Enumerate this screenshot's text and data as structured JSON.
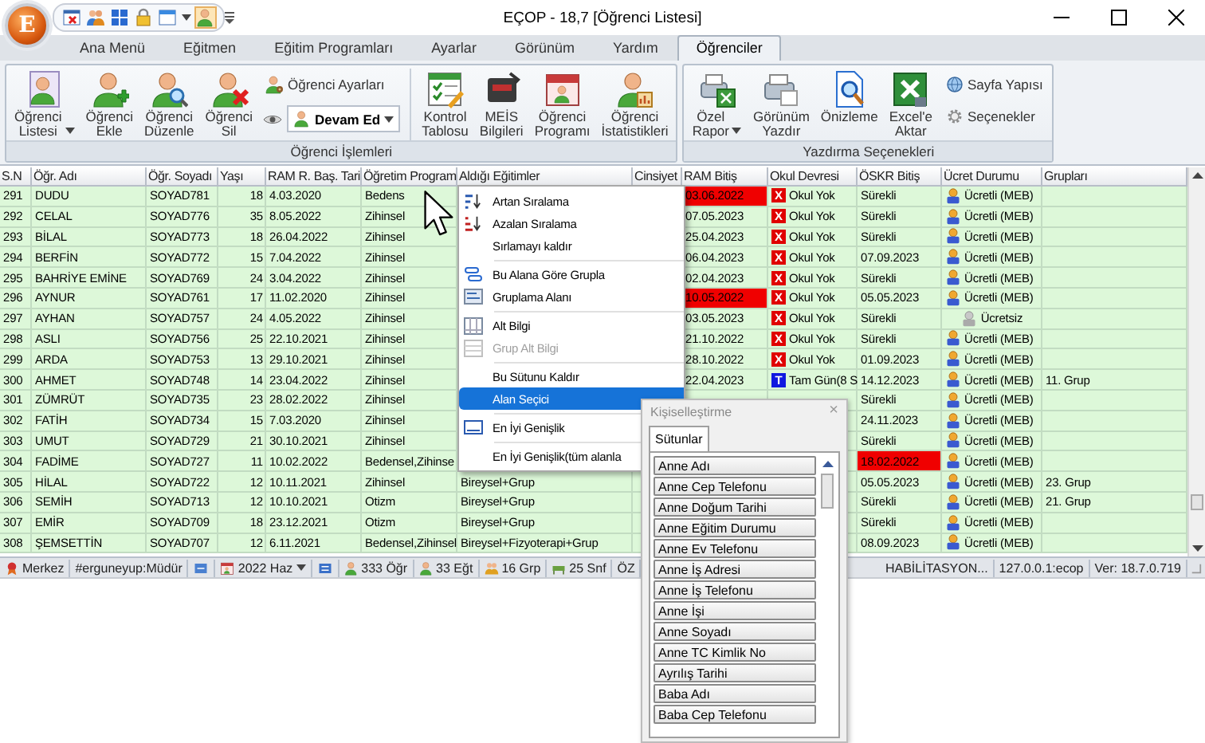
{
  "window": {
    "title": "EÇOP - 18,7 [Öğrenci Listesi]",
    "app_letter": "E"
  },
  "tabs": [
    {
      "label": "Ana Menü",
      "selected": false
    },
    {
      "label": "Eğitmen",
      "selected": false
    },
    {
      "label": "Eğitim Programları",
      "selected": false
    },
    {
      "label": "Ayarlar",
      "selected": false
    },
    {
      "label": "Görünüm",
      "selected": false
    },
    {
      "label": "Yardım",
      "selected": false
    },
    {
      "label": "Öğrenciler",
      "selected": true
    }
  ],
  "ribbon": {
    "groups": [
      {
        "label": "Öğrenci İşlemleri",
        "items": [
          {
            "kind": "large",
            "label": "Öğrenci\nListesi",
            "menu": true
          },
          {
            "kind": "large",
            "label": "Öğrenci\nEkle",
            "menu": false
          },
          {
            "kind": "large",
            "label": "Öğrenci\nDüzenle",
            "menu": false
          },
          {
            "kind": "large",
            "label": "Öğrenci\nSil",
            "menu": false
          },
          {
            "kind": "small",
            "label": "Öğrenci Ayarları"
          },
          {
            "kind": "combo",
            "value": "Devam Ed"
          },
          {
            "kind": "large",
            "label": "Kontrol\nTablosu",
            "menu": false
          },
          {
            "kind": "large",
            "label": "MEİS\nBilgileri",
            "menu": false
          },
          {
            "kind": "large",
            "label": "Öğrenci\nProgramı",
            "menu": false
          },
          {
            "kind": "large",
            "label": "Öğrenci\nİstatistikleri",
            "menu": false
          }
        ]
      },
      {
        "label": "Yazdırma Seçenekleri",
        "items": [
          {
            "kind": "large",
            "label": "Özel\nRapor",
            "menu": true
          },
          {
            "kind": "large",
            "label": "Görünüm\nYazdır",
            "menu": false
          },
          {
            "kind": "large",
            "label": "Önizleme",
            "menu": false
          },
          {
            "kind": "large",
            "label": "Excel'e\nAktar",
            "menu": false
          },
          {
            "kind": "small",
            "label": "Sayfa Yapısı"
          },
          {
            "kind": "small",
            "label": "Seçenekler"
          }
        ]
      }
    ]
  },
  "table": {
    "columns": [
      "S.N",
      "Öğr. Adı",
      "Öğr. Soyadı",
      "Yaşı",
      "RAM R. Baş. Tari",
      "Öğretim Program",
      "Aldığı Eğitimler",
      "Cinsiyet",
      "RAM Bitiş",
      "Okul Devresi",
      "ÖSKR Bitiş",
      "Ücret Durumu",
      "Grupları"
    ],
    "rows": [
      {
        "no": "291",
        "name": "DUDU",
        "surname": "SOYAD781",
        "age": "18",
        "ram_start": "4.03.2020",
        "program": "Bedens",
        "ram_end": "03.06.2022",
        "ram_end_expired": true,
        "school": {
          "kind": "none",
          "badge": "X",
          "text": "Okul Yok"
        },
        "oskr_end": "Sürekli",
        "oskr_expired": false,
        "fee": {
          "kind": "paid",
          "text": "Ücretli (MEB)"
        }
      },
      {
        "no": "292",
        "name": "CELAL",
        "surname": "SOYAD776",
        "age": "35",
        "ram_start": "8.05.2022",
        "program": "Zihinsel",
        "ram_end": "07.05.2023",
        "ram_end_expired": false,
        "school": {
          "kind": "none",
          "badge": "X",
          "text": "Okul Yok"
        },
        "oskr_end": "Sürekli",
        "oskr_expired": false,
        "fee": {
          "kind": "paid",
          "text": "Ücretli (MEB)"
        }
      },
      {
        "no": "293",
        "name": "BİLAL",
        "surname": "SOYAD773",
        "age": "18",
        "ram_start": "26.04.2022",
        "program": "Zihinsel",
        "ram_end": "25.04.2023",
        "ram_end_expired": false,
        "school": {
          "kind": "none",
          "badge": "X",
          "text": "Okul Yok"
        },
        "oskr_end": "Sürekli",
        "oskr_expired": false,
        "fee": {
          "kind": "paid",
          "text": "Ücretli (MEB)"
        }
      },
      {
        "no": "294",
        "name": "BERFİN",
        "surname": "SOYAD772",
        "age": "15",
        "ram_start": "7.04.2022",
        "program": "Zihinsel",
        "ram_end": "06.04.2023",
        "ram_end_expired": false,
        "school": {
          "kind": "none",
          "badge": "X",
          "text": "Okul Yok"
        },
        "oskr_end": "07.09.2023",
        "oskr_expired": false,
        "fee": {
          "kind": "paid",
          "text": "Ücretli (MEB)"
        }
      },
      {
        "no": "295",
        "name": "BAHRİYE EMİNE",
        "surname": "SOYAD769",
        "age": "24",
        "ram_start": "3.04.2022",
        "program": "Zihinsel",
        "ram_end": "02.04.2023",
        "ram_end_expired": false,
        "school": {
          "kind": "none",
          "badge": "X",
          "text": "Okul Yok"
        },
        "oskr_end": "Sürekli",
        "oskr_expired": false,
        "fee": {
          "kind": "paid",
          "text": "Ücretli (MEB)"
        }
      },
      {
        "no": "296",
        "name": "AYNUR",
        "surname": "SOYAD761",
        "age": "17",
        "ram_start": "11.02.2020",
        "program": "Zihinsel",
        "ram_end": "10.05.2022",
        "ram_end_expired": true,
        "school": {
          "kind": "none",
          "badge": "X",
          "text": "Okul Yok"
        },
        "oskr_end": "05.05.2023",
        "oskr_expired": false,
        "fee": {
          "kind": "paid",
          "text": "Ücretli (MEB)"
        }
      },
      {
        "no": "297",
        "name": "AYHAN",
        "surname": "SOYAD757",
        "age": "24",
        "ram_start": "4.05.2022",
        "program": "Zihinsel",
        "ram_end": "03.05.2023",
        "ram_end_expired": false,
        "school": {
          "kind": "none",
          "badge": "X",
          "text": "Okul Yok"
        },
        "oskr_end": "Sürekli",
        "oskr_expired": false,
        "fee": {
          "kind": "free",
          "text": "Ücretsiz"
        }
      },
      {
        "no": "298",
        "name": "ASLI",
        "surname": "SOYAD756",
        "age": "25",
        "ram_start": "22.10.2021",
        "program": "Zihinsel",
        "ram_end": "21.10.2022",
        "ram_end_expired": false,
        "school": {
          "kind": "none",
          "badge": "X",
          "text": "Okul Yok"
        },
        "oskr_end": "Sürekli",
        "oskr_expired": false,
        "fee": {
          "kind": "paid",
          "text": "Ücretli (MEB)"
        }
      },
      {
        "no": "299",
        "name": "ARDA",
        "surname": "SOYAD753",
        "age": "13",
        "ram_start": "29.10.2021",
        "program": "Zihinsel",
        "ram_end": "28.10.2022",
        "ram_end_expired": false,
        "school": {
          "kind": "none",
          "badge": "X",
          "text": "Okul Yok"
        },
        "oskr_end": "01.09.2023",
        "oskr_expired": false,
        "fee": {
          "kind": "paid",
          "text": "Ücretli (MEB)"
        }
      },
      {
        "no": "300",
        "name": "AHMET",
        "surname": "SOYAD748",
        "age": "14",
        "ram_start": "23.04.2022",
        "program": "Zihinsel",
        "ram_end": "22.04.2023",
        "ram_end_expired": false,
        "school": {
          "kind": "full",
          "badge": "T",
          "text": "Tam Gün(8 S"
        },
        "oskr_end": "14.12.2023",
        "oskr_expired": false,
        "fee": {
          "kind": "paid",
          "text": "Ücretli (MEB)"
        },
        "group": "11. Grup"
      },
      {
        "no": "301",
        "name": "ZÜMRÜT",
        "surname": "SOYAD735",
        "age": "23",
        "ram_start": "28.02.2022",
        "program": "Zihinsel",
        "oskr_end": "Sürekli",
        "oskr_expired": false,
        "fee": {
          "kind": "paid",
          "text": "Ücretli (MEB)"
        }
      },
      {
        "no": "302",
        "name": "FATİH",
        "surname": "SOYAD734",
        "age": "15",
        "ram_start": "7.03.2020",
        "program": "Zihinsel",
        "oskr_end": "24.11.2023",
        "oskr_expired": false,
        "fee": {
          "kind": "paid",
          "text": "Ücretli (MEB)"
        }
      },
      {
        "no": "303",
        "name": "UMUT",
        "surname": "SOYAD729",
        "age": "21",
        "ram_start": "30.10.2021",
        "program": "Zihinsel",
        "oskr_end": "Sürekli",
        "oskr_expired": false,
        "fee": {
          "kind": "paid",
          "text": "Ücretli (MEB)"
        }
      },
      {
        "no": "304",
        "name": "FADİME",
        "surname": "SOYAD727",
        "age": "11",
        "ram_start": "10.02.2022",
        "program": "Bedensel,Zihinse",
        "oskr_end": "18.02.2022",
        "oskr_expired": true,
        "fee": {
          "kind": "paid",
          "text": "Ücretli (MEB)"
        }
      },
      {
        "no": "305",
        "name": "HİLAL",
        "surname": "SOYAD722",
        "age": "12",
        "ram_start": "10.11.2021",
        "program": "Zihinsel",
        "education": "Bireysel+Grup",
        "oskr_end": "05.05.2023",
        "oskr_expired": false,
        "fee": {
          "kind": "paid",
          "text": "Ücretli (MEB)"
        },
        "group": "23. Grup"
      },
      {
        "no": "306",
        "name": "SEMİH",
        "surname": "SOYAD713",
        "age": "12",
        "ram_start": "10.10.2021",
        "program": "Otizm",
        "education": "Bireysel+Grup",
        "oskr_end": "Sürekli",
        "oskr_expired": false,
        "fee": {
          "kind": "paid",
          "text": "Ücretli (MEB)"
        },
        "group": "21. Grup"
      },
      {
        "no": "307",
        "name": "EMİR",
        "surname": "SOYAD709",
        "age": "18",
        "ram_start": "23.12.2021",
        "program": "Otizm",
        "education": "Bireysel+Grup",
        "oskr_end": "Sürekli",
        "oskr_expired": false,
        "fee": {
          "kind": "paid",
          "text": "Ücretli (MEB)"
        }
      },
      {
        "no": "308",
        "name": "ŞEMSETTİN",
        "surname": "SOYAD707",
        "age": "12",
        "ram_start": "6.11.2021",
        "program": "Bedensel,Zihinsel",
        "education": "Bireysel+Fizyoterapi+Grup",
        "oskr_end": "08.09.2023",
        "oskr_expired": false,
        "fee": {
          "kind": "paid",
          "text": "Ücretli (MEB)"
        }
      }
    ]
  },
  "context_menu": {
    "items": [
      {
        "kind": "item",
        "label": "Artan Sıralama",
        "disabled": false,
        "selected": false
      },
      {
        "kind": "item",
        "label": "Azalan Sıralama",
        "disabled": false,
        "selected": false
      },
      {
        "kind": "item",
        "label": "Sırlamayı kaldır",
        "disabled": false,
        "selected": false
      },
      {
        "kind": "separator"
      },
      {
        "kind": "item",
        "label": "Bu Alana Göre Grupla",
        "disabled": false,
        "selected": false
      },
      {
        "kind": "item",
        "label": "Gruplama Alanı",
        "disabled": false,
        "selected": false
      },
      {
        "kind": "separator"
      },
      {
        "kind": "item",
        "label": "Alt Bilgi",
        "disabled": false,
        "selected": false
      },
      {
        "kind": "item",
        "label": "Grup Alt Bilgi",
        "disabled": true,
        "selected": false
      },
      {
        "kind": "separator"
      },
      {
        "kind": "item",
        "label": "Bu Sütunu Kaldır",
        "disabled": false,
        "selected": false
      },
      {
        "kind": "item",
        "label": "Alan Seçici",
        "disabled": false,
        "selected": true
      },
      {
        "kind": "separator"
      },
      {
        "kind": "item",
        "label": "En İyi Genişlik",
        "disabled": false,
        "selected": false
      },
      {
        "kind": "separator"
      },
      {
        "kind": "item",
        "label": "En İyi Genişlik(tüm alanla",
        "disabled": false,
        "selected": false
      }
    ]
  },
  "customization": {
    "title": "Kişiselleştirme",
    "close": "×",
    "tab": "Sütunlar",
    "fields": [
      "Anne Adı",
      "Anne Cep Telefonu",
      "Anne Doğum Tarihi",
      "Anne Eğitim Durumu",
      "Anne Ev Telefonu",
      "Anne İş Adresi",
      "Anne İş Telefonu",
      "Anne İşi",
      "Anne Soyadı",
      "Anne TC Kimlik No",
      "Ayrılış Tarihi",
      "Baba Adı",
      "Baba Cep Telefonu"
    ]
  },
  "status_bar": {
    "branch": "Merkez",
    "user": "#erguneyup:Müdür",
    "period": "2022 Haz",
    "counts": [
      "333 Öğr",
      "33 Eğt",
      "16 Grp",
      "25 Snf"
    ],
    "institution_start": "ÖZ",
    "institution_end": "HABİLİTASYON...",
    "server": "127.0.0.1:ecop",
    "version": "Ver: 18.7.0.719"
  }
}
